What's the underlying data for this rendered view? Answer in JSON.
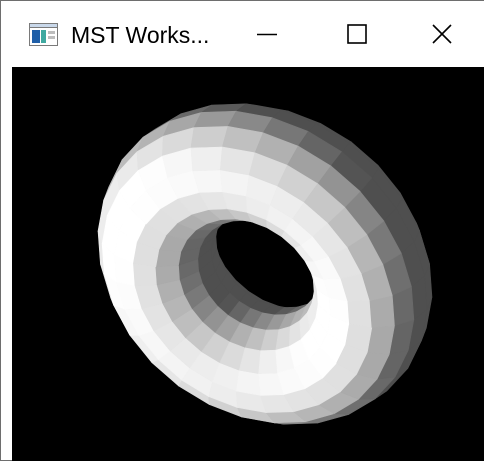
{
  "window": {
    "title": "MST Works...",
    "app_icon": "app-window-icon",
    "controls": {
      "minimize_icon": "minimize-icon",
      "maximize_icon": "maximize-icon",
      "close_icon": "close-icon"
    }
  },
  "viewport": {
    "background": "#000000",
    "scene": "shaded-torus"
  },
  "colors": {
    "titlebar": "#ffffff",
    "title_text": "#000000",
    "icon_blue": "#1f5fa8",
    "icon_teal": "#3fa9a0"
  }
}
